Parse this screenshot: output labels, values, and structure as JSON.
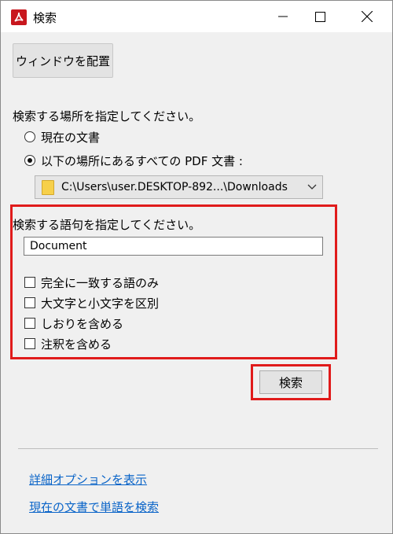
{
  "window": {
    "title": "検索"
  },
  "buttons": {
    "place_window": "ウィンドウを配置",
    "search": "検索"
  },
  "location": {
    "prompt": "検索する場所を指定してください。",
    "option_current": "現在の文書",
    "option_all": "以下の場所にあるすべての PDF 文書 :",
    "folder_path": "C:\\Users\\user.DESKTOP-892...\\Downloads"
  },
  "terms": {
    "prompt": "検索する語句を指定してください。",
    "value": "Document",
    "options": [
      "完全に一致する語のみ",
      "大文字と小文字を区別",
      "しおりを含める",
      "注釈を含める"
    ]
  },
  "links": {
    "advanced": "詳細オプションを表示",
    "find_in_current": "現在の文書で単語を検索"
  },
  "colors": {
    "highlight": "#e01b1b",
    "link": "#0a64c8",
    "app_icon": "#c8171e"
  },
  "icons": {
    "app": "acrobat-icon",
    "minimize": "minimize-icon",
    "maximize": "maximize-icon",
    "close": "close-icon",
    "folder": "folder-icon",
    "dropdown": "chevron-down-icon"
  }
}
